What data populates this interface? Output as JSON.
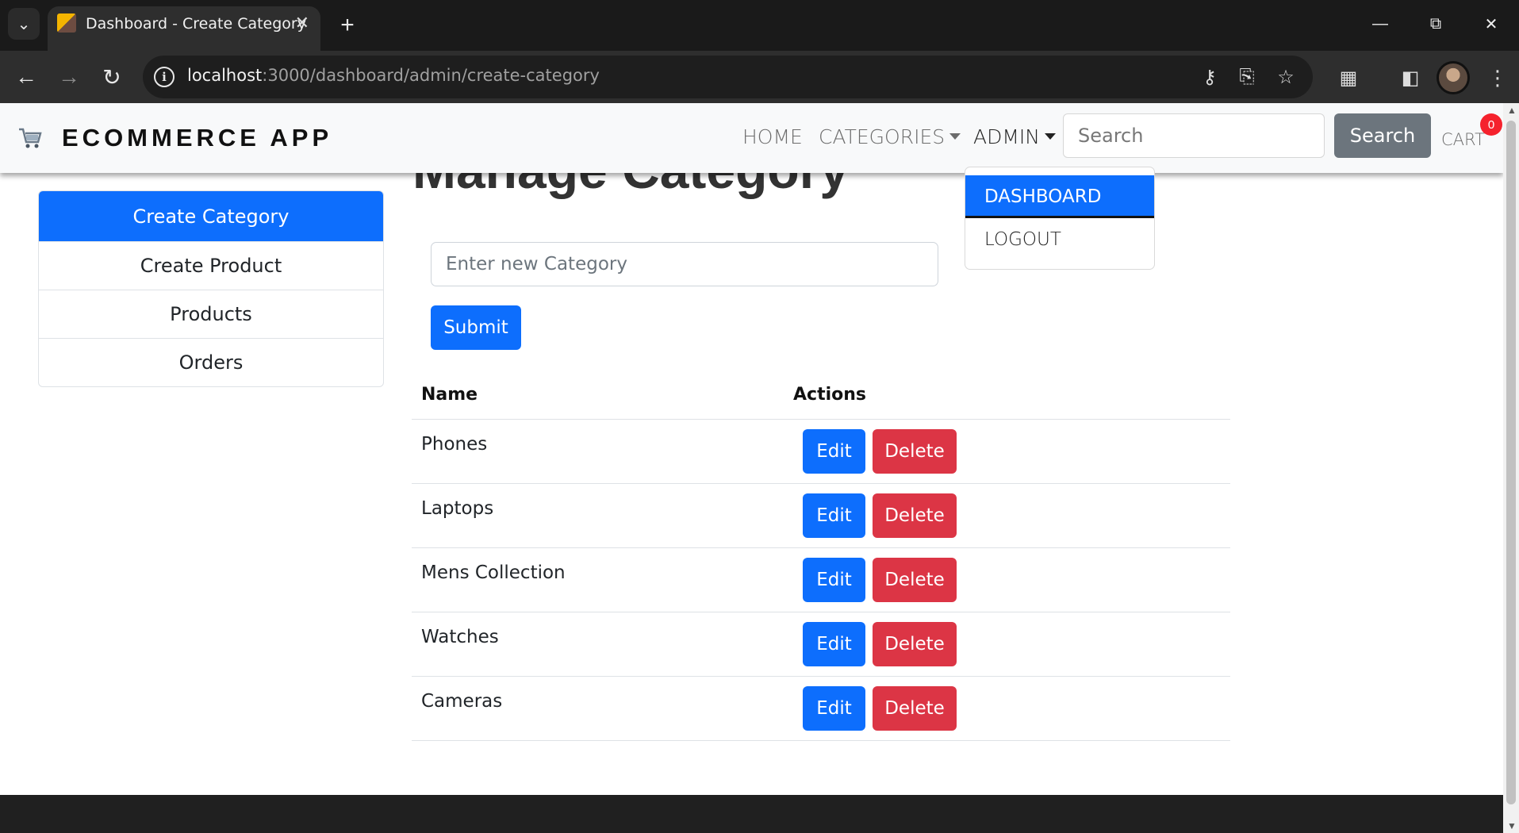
{
  "browser": {
    "tab_title": "Dashboard - Create Category",
    "url_host": "localhost",
    "url_path": ":3000/dashboard/admin/create-category"
  },
  "navbar": {
    "brand": "ECOMMERCE APP",
    "links": {
      "home": "HOME",
      "categories": "CATEGORIES",
      "admin": "ADMIN"
    },
    "search_placeholder": "Search",
    "search_button": "Search",
    "cart_label": "CART",
    "cart_count": "0"
  },
  "admin_dropdown": {
    "items": [
      "DASHBOARD",
      "LOGOUT"
    ]
  },
  "admin_menu": {
    "items": [
      "Create Category",
      "Create Product",
      "Products",
      "Orders"
    ]
  },
  "main": {
    "title": "Manage Category",
    "category_input_placeholder": "Enter new Category",
    "submit_label": "Submit",
    "table": {
      "headers": [
        "Name",
        "Actions"
      ],
      "rows": [
        "Phones",
        "Laptops",
        "Mens Collection",
        "Watches",
        "Cameras"
      ],
      "edit_label": "Edit",
      "delete_label": "Delete"
    }
  },
  "colors": {
    "primary": "#0d6efd",
    "danger": "#dc3545",
    "secondary": "#6c757d",
    "badge": "#f5222d"
  }
}
